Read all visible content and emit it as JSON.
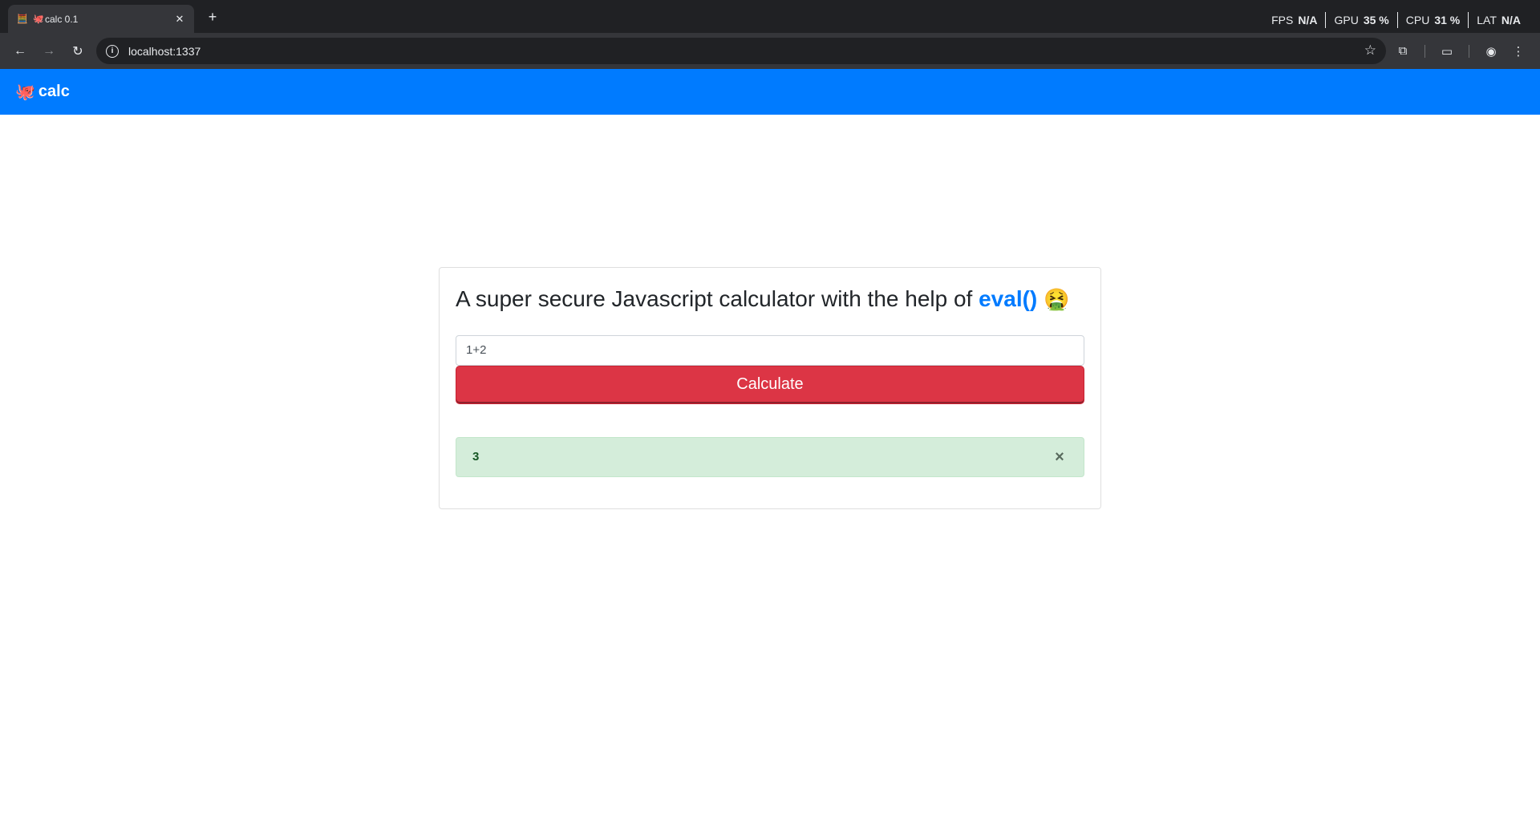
{
  "browser": {
    "tab": {
      "title": "calc 0.1",
      "favicon": "calculator-icon"
    },
    "perf": [
      {
        "label": "FPS",
        "value": "N/A"
      },
      {
        "label": "GPU",
        "value": "35 %"
      },
      {
        "label": "CPU",
        "value": "31 %"
      },
      {
        "label": "LAT",
        "value": "N/A"
      }
    ],
    "url": "localhost:1337"
  },
  "navbar": {
    "brand": "calc",
    "brand_icon": "🐙"
  },
  "card": {
    "title_prefix": "A super secure Javascript calculator with the help of ",
    "title_highlight": "eval()",
    "title_emoji": "🤮"
  },
  "form": {
    "input_value": "1+2",
    "button_label": "Calculate"
  },
  "result": {
    "value": "3",
    "close": "×"
  },
  "colors": {
    "navbar": "#007bff",
    "button": "#dc3545",
    "alert_bg": "#d4edda",
    "alert_text": "#155724"
  }
}
